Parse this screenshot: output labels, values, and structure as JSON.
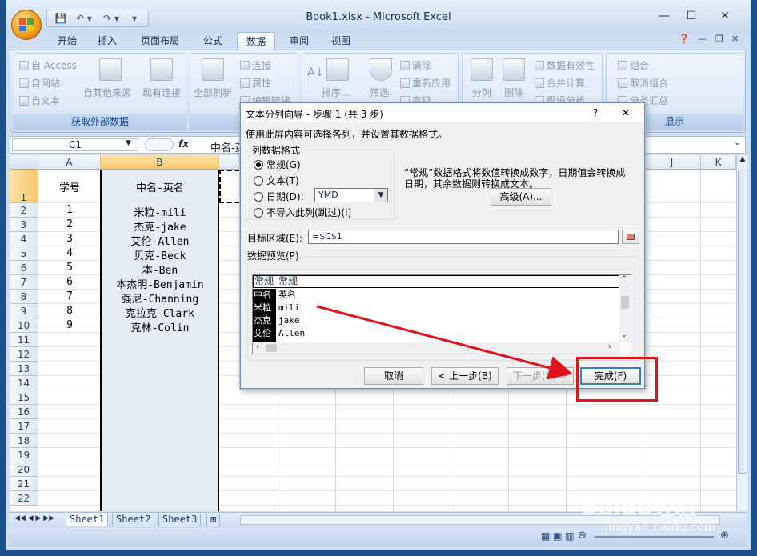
{
  "window": {
    "title": "Book1.xlsx - Microsoft Excel",
    "minimize": "—",
    "maximize": "☐",
    "close": "✕"
  },
  "qat": {
    "save": "💾",
    "undo": "↶ ▾",
    "redo": "↷ ▾",
    "customize": "▾"
  },
  "tabs": [
    "开始",
    "插入",
    "页面布局",
    "公式",
    "数据",
    "审阅",
    "视图"
  ],
  "active_tab": "数据",
  "ribbon": {
    "ext_data": {
      "access": "自 Access",
      "web": "自网站",
      "text": "自文本",
      "other": "自其他来源",
      "existing": "现有连接",
      "label": "获取外部数据"
    },
    "connections": {
      "refresh_all": "全部刷新",
      "connections": "连接",
      "properties": "属性",
      "edit_links": "编辑链接",
      "label": "连"
    },
    "sort": {
      "sort": "排序...",
      "filter": "筛选",
      "clear": "清除",
      "reapply": "重新应用",
      "advanced": "高级"
    },
    "tools": {
      "text_to_columns": "分列",
      "remove_dup": "删除",
      "validation": "数据有效性",
      "consolidate": "合并计算",
      "whatif": "假设分析"
    },
    "outline": {
      "group": "组合",
      "ungroup": "取消组合",
      "subtotal": "分类汇总",
      "label": "显示"
    }
  },
  "formula_bar": {
    "name_box": "C1",
    "fx": "fx",
    "content": "中名-英"
  },
  "columns": [
    "A",
    "B",
    "C",
    "D",
    "E",
    "F",
    "G",
    "H",
    "I",
    "J",
    "K"
  ],
  "rows": [
    "1",
    "2",
    "3",
    "4",
    "5",
    "6",
    "7",
    "8",
    "9",
    "10",
    "11",
    "12",
    "13",
    "14",
    "15",
    "16",
    "17",
    "18",
    "19",
    "20",
    "21",
    "22"
  ],
  "cells": {
    "A": [
      "学号",
      "1",
      "2",
      "3",
      "4",
      "5",
      "6",
      "7",
      "8",
      "9"
    ],
    "B": [
      "中名-英名",
      "米粒-mili",
      "杰克-jake",
      "艾伦-Allen",
      "贝克-Beck",
      "本-Ben",
      "本杰明-Benjamin",
      "强尼-Channing",
      "克拉克-Clark",
      "克林-Colin"
    ]
  },
  "sheets": [
    "Sheet1",
    "Sheet2",
    "Sheet3"
  ],
  "dialog": {
    "title": "文本分列向导 - 步骤 1 (共 3 步)",
    "help": "?",
    "close": "✕",
    "instruction": "使用此屏内容可选择各列，并设置其数据格式。",
    "group_label": "列数据格式",
    "radios": [
      "常规(G)",
      "文本(T)",
      "日期(D):",
      "不导入此列(跳过)(I)"
    ],
    "date_format": "YMD",
    "info": [
      "“常规”数据格式将数值转换成数字，日期值会转换成",
      "日期，其余数据则转换成文本。"
    ],
    "advanced_btn": "高级(A)...",
    "dest_label": "目标区域(E):",
    "dest_value": "=$C$1",
    "preview_label": "数据预览(P)",
    "preview_header": [
      "常规",
      "常规"
    ],
    "preview_rows": [
      [
        "中名",
        "英名"
      ],
      [
        "米粒",
        "mili"
      ],
      [
        "杰克",
        "jake"
      ],
      [
        "艾伦",
        "Allen"
      ]
    ],
    "buttons": {
      "cancel": "取消",
      "back": "< 上一步(B)",
      "next": "下一步(N) >",
      "finish": "完成(F)"
    }
  },
  "watermark": {
    "brand": "Baidu经验",
    "url": "jingyan.baidu.com"
  },
  "colors": {
    "annotation_red": "#e0121b",
    "selection_header": "#f8c96d"
  }
}
